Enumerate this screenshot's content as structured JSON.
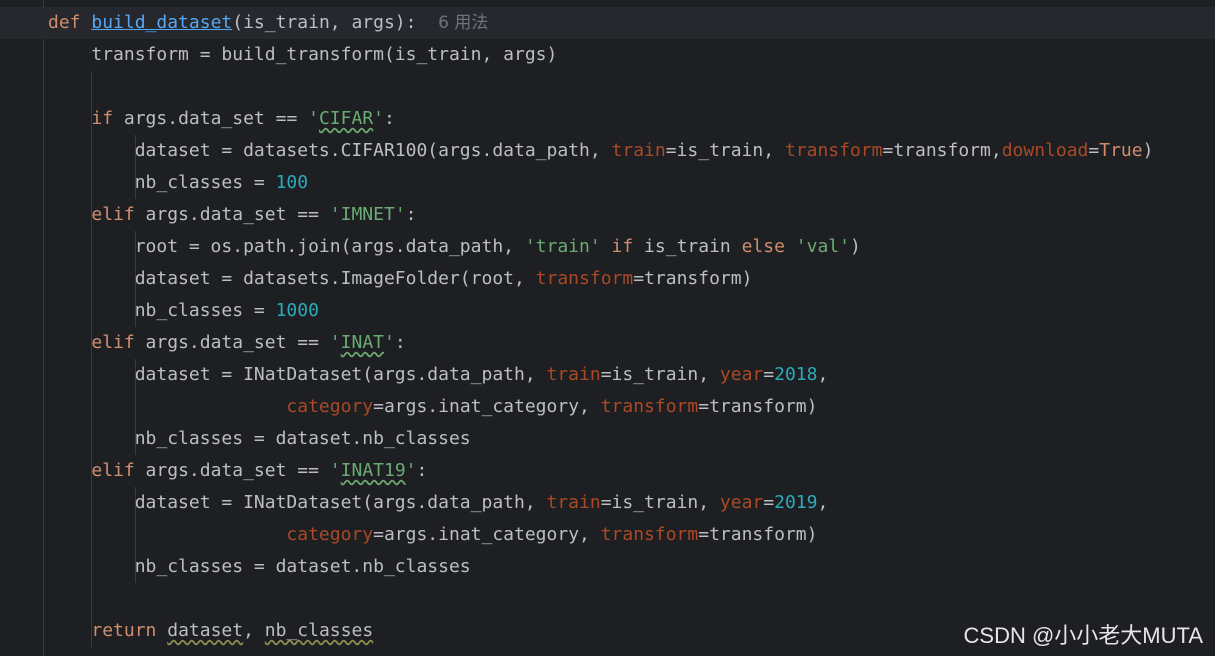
{
  "editor": {
    "watermark": "CSDN @小小老大MUTA",
    "usage_hint": "6 用法",
    "lines": [
      [
        {
          "t": "def ",
          "c": "kw"
        },
        {
          "t": "build_dataset",
          "c": "fn"
        },
        {
          "t": "(is_train, args):  ",
          "c": ""
        }
      ],
      [
        {
          "t": "    transform = build_transform(is_train, args)",
          "c": ""
        }
      ],
      [],
      [
        {
          "t": "    ",
          "c": ""
        },
        {
          "t": "if",
          "c": "kw"
        },
        {
          "t": " args.data_set == ",
          "c": ""
        },
        {
          "t": "'",
          "c": "str"
        },
        {
          "t": "CIFAR",
          "c": "str typo"
        },
        {
          "t": "'",
          "c": "str"
        },
        {
          "t": ":",
          "c": ""
        }
      ],
      [
        {
          "t": "        dataset = datasets.CIFAR100(args.data_path, ",
          "c": ""
        },
        {
          "t": "train",
          "c": "param"
        },
        {
          "t": "=is_train, ",
          "c": ""
        },
        {
          "t": "transform",
          "c": "param"
        },
        {
          "t": "=transform,",
          "c": ""
        },
        {
          "t": "download",
          "c": "param"
        },
        {
          "t": "=",
          "c": ""
        },
        {
          "t": "True",
          "c": "kw"
        },
        {
          "t": ")",
          "c": ""
        }
      ],
      [
        {
          "t": "        nb_classes = ",
          "c": ""
        },
        {
          "t": "100",
          "c": "num"
        }
      ],
      [
        {
          "t": "    ",
          "c": ""
        },
        {
          "t": "elif",
          "c": "kw"
        },
        {
          "t": " args.data_set == ",
          "c": ""
        },
        {
          "t": "'IMNET'",
          "c": "str"
        },
        {
          "t": ":",
          "c": ""
        }
      ],
      [
        {
          "t": "        root = os.path.join(args.data_path, ",
          "c": ""
        },
        {
          "t": "'train'",
          "c": "str"
        },
        {
          "t": " ",
          "c": ""
        },
        {
          "t": "if",
          "c": "kw"
        },
        {
          "t": " is_train ",
          "c": ""
        },
        {
          "t": "else",
          "c": "kw"
        },
        {
          "t": " ",
          "c": ""
        },
        {
          "t": "'val'",
          "c": "str"
        },
        {
          "t": ")",
          "c": ""
        }
      ],
      [
        {
          "t": "        dataset = datasets.ImageFolder(root, ",
          "c": ""
        },
        {
          "t": "transform",
          "c": "param"
        },
        {
          "t": "=transform)",
          "c": ""
        }
      ],
      [
        {
          "t": "        nb_classes = ",
          "c": ""
        },
        {
          "t": "1000",
          "c": "num"
        }
      ],
      [
        {
          "t": "    ",
          "c": ""
        },
        {
          "t": "elif",
          "c": "kw"
        },
        {
          "t": " args.data_set == ",
          "c": ""
        },
        {
          "t": "'",
          "c": "str"
        },
        {
          "t": "INAT",
          "c": "str typo"
        },
        {
          "t": "'",
          "c": "str"
        },
        {
          "t": ":",
          "c": ""
        }
      ],
      [
        {
          "t": "        dataset = INatDataset(args.data_path, ",
          "c": ""
        },
        {
          "t": "train",
          "c": "param"
        },
        {
          "t": "=is_train, ",
          "c": ""
        },
        {
          "t": "year",
          "c": "param"
        },
        {
          "t": "=",
          "c": ""
        },
        {
          "t": "2018",
          "c": "num"
        },
        {
          "t": ",",
          "c": ""
        }
      ],
      [
        {
          "t": "                      ",
          "c": ""
        },
        {
          "t": "category",
          "c": "param"
        },
        {
          "t": "=args.inat_category, ",
          "c": ""
        },
        {
          "t": "transform",
          "c": "param"
        },
        {
          "t": "=transform)",
          "c": ""
        }
      ],
      [
        {
          "t": "        nb_classes = dataset.nb_classes",
          "c": ""
        }
      ],
      [
        {
          "t": "    ",
          "c": ""
        },
        {
          "t": "elif",
          "c": "kw"
        },
        {
          "t": " args.data_set == ",
          "c": ""
        },
        {
          "t": "'",
          "c": "str"
        },
        {
          "t": "INAT19",
          "c": "str typo"
        },
        {
          "t": "'",
          "c": "str"
        },
        {
          "t": ":",
          "c": ""
        }
      ],
      [
        {
          "t": "        dataset = INatDataset(args.data_path, ",
          "c": ""
        },
        {
          "t": "train",
          "c": "param"
        },
        {
          "t": "=is_train, ",
          "c": ""
        },
        {
          "t": "year",
          "c": "param"
        },
        {
          "t": "=",
          "c": ""
        },
        {
          "t": "2019",
          "c": "num"
        },
        {
          "t": ",",
          "c": ""
        }
      ],
      [
        {
          "t": "                      ",
          "c": ""
        },
        {
          "t": "category",
          "c": "param"
        },
        {
          "t": "=args.inat_category, ",
          "c": ""
        },
        {
          "t": "transform",
          "c": "param"
        },
        {
          "t": "=transform)",
          "c": ""
        }
      ],
      [
        {
          "t": "        nb_classes = dataset.nb_classes",
          "c": ""
        }
      ],
      [],
      [
        {
          "t": "    ",
          "c": ""
        },
        {
          "t": "return",
          "c": "kw"
        },
        {
          "t": " ",
          "c": ""
        },
        {
          "t": "dataset",
          "c": "typo-plain"
        },
        {
          "t": ", ",
          "c": ""
        },
        {
          "t": "nb_classes",
          "c": "typo-plain"
        }
      ]
    ]
  }
}
